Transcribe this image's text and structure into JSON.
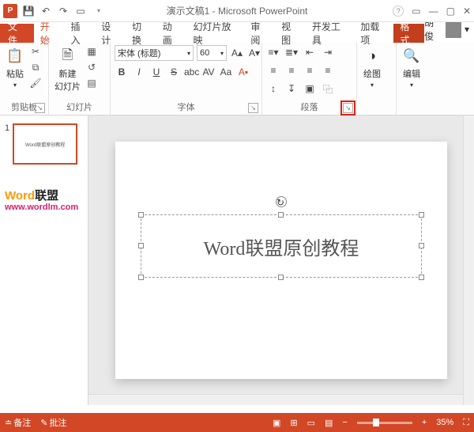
{
  "title": "演示文稿1 - Microsoft PowerPoint",
  "file_tab": "文件",
  "tabs": [
    "开始",
    "插入",
    "设计",
    "切换",
    "动画",
    "幻灯片放映",
    "审阅",
    "视图",
    "开发工具",
    "加载项",
    "格式"
  ],
  "active_tab_index": 0,
  "user_name": "胡俊",
  "groups": {
    "clipboard": {
      "label": "剪贴板",
      "paste": "粘贴"
    },
    "slides": {
      "label": "幻灯片",
      "new_slide": "新建\n幻灯片"
    },
    "font": {
      "label": "字体",
      "name": "宋体 (标题)",
      "size": "60"
    },
    "paragraph": {
      "label": "段落"
    },
    "drawing": {
      "label": "绘图",
      "btn": "绘图"
    },
    "editing": {
      "label": "编辑",
      "btn": "编辑"
    }
  },
  "thumbnail": {
    "num": "1",
    "mini_text": "Word联盟原创教程"
  },
  "watermark": {
    "p1": "Word",
    "p2": "联盟",
    "url": "www.wordlm.com"
  },
  "slide_text": "Word联盟原创教程",
  "status": {
    "notes": "备注",
    "comments": "批注",
    "zoom": "35%"
  }
}
